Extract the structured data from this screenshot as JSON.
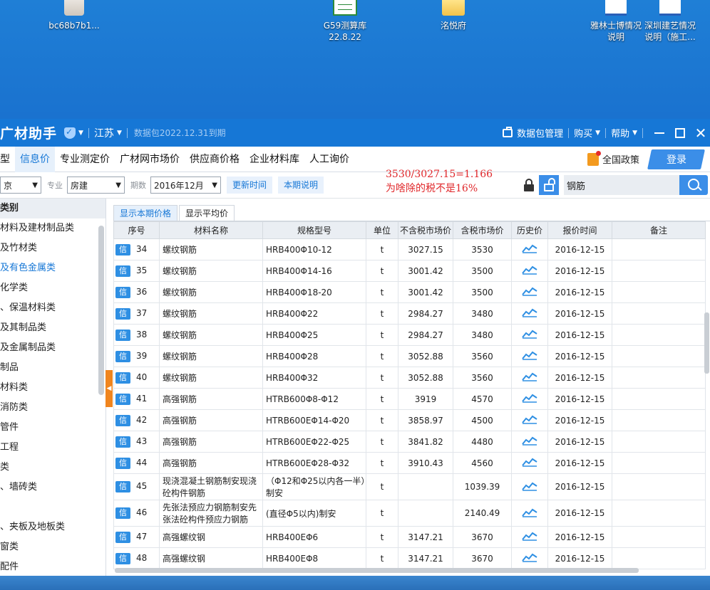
{
  "desktop": {
    "icons": [
      {
        "label": "bc68b7b1..."
      },
      {
        "label": "G59测算库",
        "label2": "22.8.22"
      },
      {
        "label": "洺悦府"
      },
      {
        "label": "雅林士博情况",
        "label2": "说明"
      },
      {
        "label": "深圳建艺情况",
        "label2": "说明（施工..."
      }
    ]
  },
  "titlebar": {
    "app_name": "广材助手",
    "region": "江苏",
    "package": "数据包2022.12.31到期",
    "package_manage": "数据包管理",
    "buy": "购买",
    "help": "帮助"
  },
  "nav": {
    "tabs": [
      "型",
      "信息价",
      "专业测定价",
      "广材网市场价",
      "供应商价格",
      "企业材料库",
      "人工询价"
    ],
    "policy": "全国政策",
    "login": "登录"
  },
  "filter": {
    "city_value": "京",
    "major_label": "专业",
    "major_value": "房建",
    "period_label": "期数",
    "period_value": "2016年12月",
    "update_time": "更新时间",
    "period_note": "本期说明",
    "annotation_line1": "3530/3027.15=1.166",
    "annotation_line2": "为啥除的税不是16%",
    "search_value": "钢筋"
  },
  "sidebar": {
    "header": "类别",
    "items": [
      "材料及建材制品类",
      "及竹材类",
      "及有色金属类",
      "化学类",
      "、保温材料类",
      "及其制品类",
      "及金属制品类",
      "制品",
      "材料类",
      "消防类",
      "管件",
      "工程",
      "类",
      "、墙砖类",
      "",
      "、夹板及地板类",
      "窗类",
      "配件"
    ],
    "active_index": 2
  },
  "subtabs": [
    "显示本期价格",
    "显示平均价"
  ],
  "table": {
    "headers": [
      "序号",
      "材料名称",
      "规格型号",
      "单位",
      "不含税市场价",
      "含税市场价",
      "历史价",
      "报价时间",
      "备注"
    ],
    "badge": "信",
    "rows": [
      {
        "no": "34",
        "name": "螺纹钢筋",
        "spec": "HRB400Φ10-12",
        "unit": "t",
        "ex_tax": "3027.15",
        "in_tax": "3530",
        "date": "2016-12-15"
      },
      {
        "no": "35",
        "name": "螺纹钢筋",
        "spec": "HRB400Φ14-16",
        "unit": "t",
        "ex_tax": "3001.42",
        "in_tax": "3500",
        "date": "2016-12-15"
      },
      {
        "no": "36",
        "name": "螺纹钢筋",
        "spec": "HRB400Φ18-20",
        "unit": "t",
        "ex_tax": "3001.42",
        "in_tax": "3500",
        "date": "2016-12-15"
      },
      {
        "no": "37",
        "name": "螺纹钢筋",
        "spec": "HRB400Φ22",
        "unit": "t",
        "ex_tax": "2984.27",
        "in_tax": "3480",
        "date": "2016-12-15"
      },
      {
        "no": "38",
        "name": "螺纹钢筋",
        "spec": "HRB400Φ25",
        "unit": "t",
        "ex_tax": "2984.27",
        "in_tax": "3480",
        "date": "2016-12-15"
      },
      {
        "no": "39",
        "name": "螺纹钢筋",
        "spec": "HRB400Φ28",
        "unit": "t",
        "ex_tax": "3052.88",
        "in_tax": "3560",
        "date": "2016-12-15"
      },
      {
        "no": "40",
        "name": "螺纹钢筋",
        "spec": "HRB400Φ32",
        "unit": "t",
        "ex_tax": "3052.88",
        "in_tax": "3560",
        "date": "2016-12-15"
      },
      {
        "no": "41",
        "name": "高强钢筋",
        "spec": "HTRB600Φ8-Φ12",
        "unit": "t",
        "ex_tax": "3919",
        "in_tax": "4570",
        "date": "2016-12-15"
      },
      {
        "no": "42",
        "name": "高强钢筋",
        "spec": "HTRB600EΦ14-Φ20",
        "unit": "t",
        "ex_tax": "3858.97",
        "in_tax": "4500",
        "date": "2016-12-15"
      },
      {
        "no": "43",
        "name": "高强钢筋",
        "spec": "HTRB600EΦ22-Φ25",
        "unit": "t",
        "ex_tax": "3841.82",
        "in_tax": "4480",
        "date": "2016-12-15"
      },
      {
        "no": "44",
        "name": "高强钢筋",
        "spec": "HTRB600EΦ28-Φ32",
        "unit": "t",
        "ex_tax": "3910.43",
        "in_tax": "4560",
        "date": "2016-12-15"
      },
      {
        "no": "45",
        "name": "现浇混凝土钢筋制安现浇砼构件钢筋",
        "spec": "（Φ12和Φ25以内各一半）制安",
        "unit": "t",
        "ex_tax": "",
        "in_tax": "1039.39",
        "date": "2016-12-15",
        "tall": true
      },
      {
        "no": "46",
        "name": "先张法预应力钢筋制安先张法砼构件预应力钢筋",
        "spec": "(直径Φ5以内)制安",
        "unit": "t",
        "ex_tax": "",
        "in_tax": "2140.49",
        "date": "2016-12-15",
        "tall": true
      },
      {
        "no": "47",
        "name": "高强螺纹钢",
        "spec": "HRB400EΦ6",
        "unit": "t",
        "ex_tax": "3147.21",
        "in_tax": "3670",
        "date": "2016-12-15"
      },
      {
        "no": "48",
        "name": "高强螺纹钢",
        "spec": "HRB400EΦ8",
        "unit": "t",
        "ex_tax": "3147.21",
        "in_tax": "3670",
        "date": "2016-12-15"
      }
    ]
  }
}
